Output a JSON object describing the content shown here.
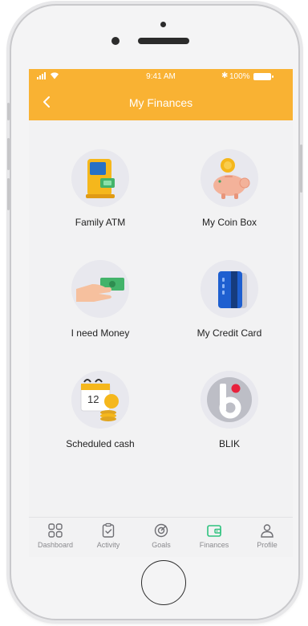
{
  "status_bar": {
    "time": "9:41 AM",
    "battery": "100%"
  },
  "header": {
    "title": "My Finances"
  },
  "tiles": [
    {
      "label": "Family ATM",
      "icon": "atm-icon"
    },
    {
      "label": "My Coin Box",
      "icon": "piggy-bank-icon"
    },
    {
      "label": "I need Money",
      "icon": "hand-money-icon"
    },
    {
      "label": "My Credit Card",
      "icon": "credit-card-icon"
    },
    {
      "label": "Scheduled cash",
      "icon": "calendar-coins-icon"
    },
    {
      "label": "BLIK",
      "icon": "blik-logo-icon"
    }
  ],
  "tab_bar": {
    "items": [
      {
        "label": "Dashboard",
        "icon": "grid-icon"
      },
      {
        "label": "Activity",
        "icon": "clipboard-check-icon"
      },
      {
        "label": "Goals",
        "icon": "target-icon"
      },
      {
        "label": "Finances",
        "icon": "wallet-icon",
        "active": true
      },
      {
        "label": "Profile",
        "icon": "person-icon"
      }
    ]
  },
  "colors": {
    "accent": "#f9b233",
    "active_tab": "#2ec27e",
    "tab_inactive": "#8a8a8e"
  }
}
